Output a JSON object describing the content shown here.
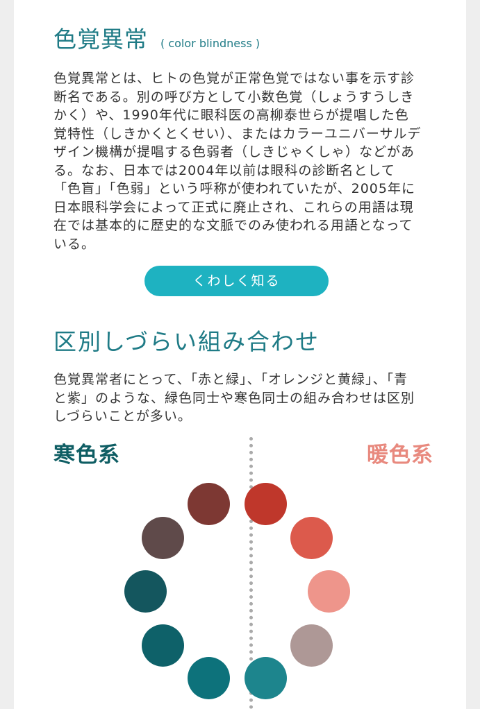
{
  "header": {
    "title": "色覚異常",
    "subtitle": "( color blindness )"
  },
  "intro": {
    "text": "色覚異常とは、ヒトの色覚が正常色覚ではない事を示す診断名である。別の呼び方として小数色覚（しょうすうしきかく）や、1990年代に眼科医の高柳泰世らが提唱した色覚特性（しきかくとくせい）、またはカラーユニバーサルデザイン機構が提唱する色弱者（しきじゃくしゃ）などがある。なお、日本では2004年以前は眼科の診断名として「色盲」「色弱」という呼称が使われていたが、2005年に日本眼科学会によって正式に廃止され、これらの用語は現在では基本的に歴史的な文脈でのみ使われる用語となっている。"
  },
  "learn_more_button": {
    "label": "くわしく知る"
  },
  "section2": {
    "heading": "区別しづらい組み合わせ",
    "text": "色覚異常者にとって、「赤と緑」、「オレンジと黄緑」、「青と紫」のような、緑色同士や寒色同士の組み合わせは区別しづらいことが多い。"
  },
  "palette": {
    "cold_label": "寒色系",
    "warm_label": "暖色系",
    "cold_colors": [
      "#7d3833",
      "#5f4a4a",
      "#14565e",
      "#0e6169",
      "#0d727b"
    ],
    "warm_colors": [
      "#bf372b",
      "#dc5a4c",
      "#ee958b",
      "#ae9896",
      "#1d858d"
    ]
  }
}
